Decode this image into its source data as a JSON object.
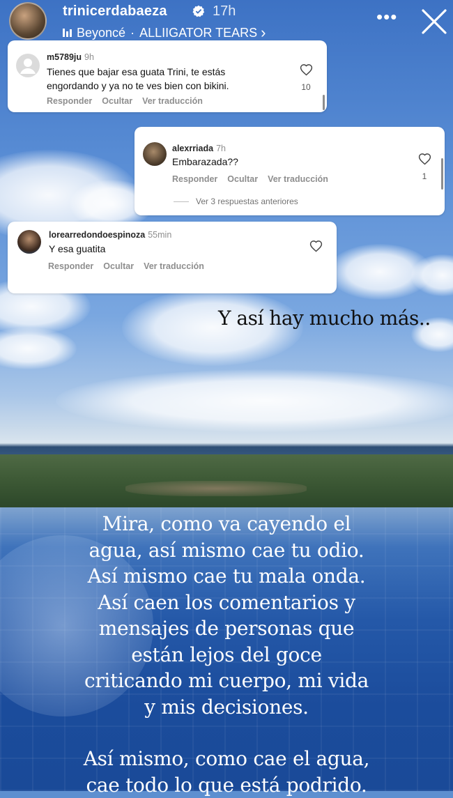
{
  "story": {
    "username": "trinicerdabaeza",
    "time_ago": "17h",
    "music": {
      "artist": "Beyoncé",
      "separator": "·",
      "song": "ALLIIGATOR TEARS",
      "chevron": "›"
    },
    "more_label": "•••",
    "icons": {
      "verified": "verified-badge-icon",
      "close": "close-icon",
      "music": "music-bars-icon",
      "heart": "heart-outline-icon"
    }
  },
  "comments": [
    {
      "user": "m5789ju",
      "ago": "9h",
      "text_lines": [
        "Tienes que bajar esa guata Trini, te estás",
        "engordando y ya no te ves bien con bikini."
      ],
      "actions": [
        "Responder",
        "Ocultar",
        "Ver traducción"
      ],
      "likes": "10"
    },
    {
      "user": "alexrriada",
      "ago": "7h",
      "text_lines": [
        "Embarazada??"
      ],
      "actions": [
        "Responder",
        "Ocultar",
        "Ver traducción"
      ],
      "likes": "1",
      "view_previous": "Ver 3 respuestas anteriores"
    },
    {
      "user": "lorearredondoespinoza",
      "ago": "55min",
      "text_lines": [
        "Y esa guatita"
      ],
      "actions": [
        "Responder",
        "Ocultar",
        "Ver traducción"
      ],
      "likes": ""
    }
  ],
  "overlay_text_top": "Y así hay mucho más..",
  "overlay_text_bottom": {
    "paragraph1": [
      "Mira, como va cayendo el",
      "agua, así mismo cae tu odio.",
      "Así mismo cae tu mala onda.",
      "Así caen los comentarios y",
      "mensajes de personas que",
      "están lejos del goce",
      "criticando mi cuerpo, mi vida",
      "y mis decisiones."
    ],
    "paragraph2": [
      "Así mismo, como cae el agua,",
      "cae todo lo que está podrido."
    ]
  }
}
